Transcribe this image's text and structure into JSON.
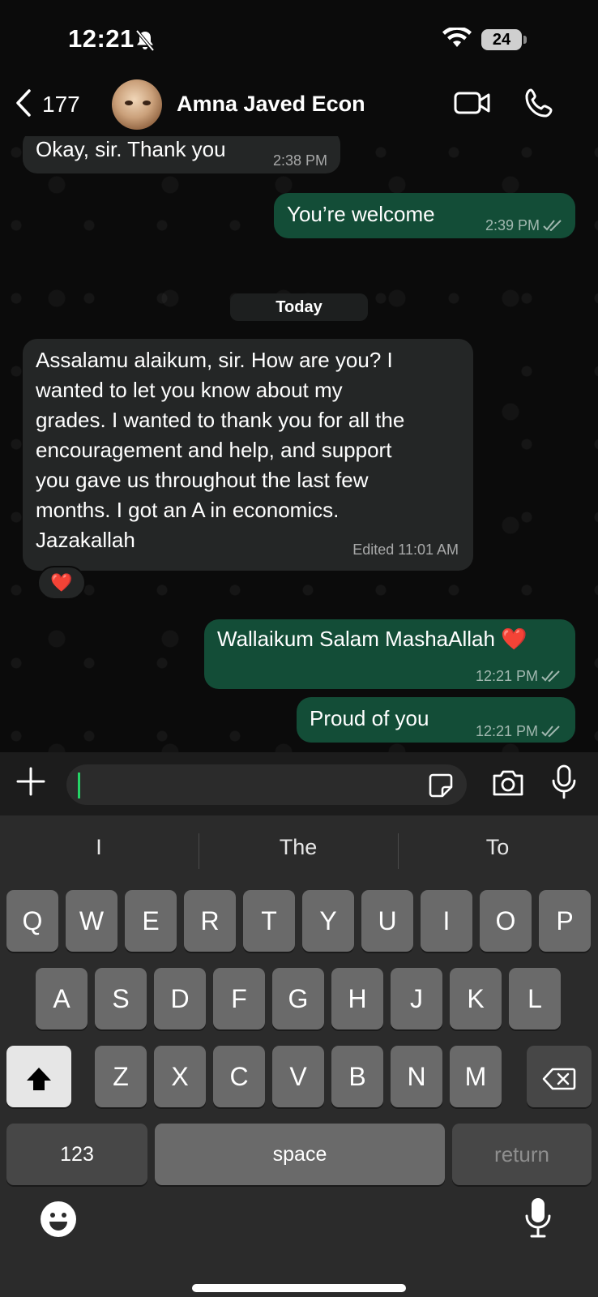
{
  "status_bar": {
    "time": "12:21",
    "battery": "24"
  },
  "header": {
    "back_count": "177",
    "contact_name": "Amna Javed Econ"
  },
  "messages": [
    {
      "direction": "in",
      "text": "Okay, sir. Thank you",
      "time": "2:38 PM"
    },
    {
      "direction": "out",
      "text": "You’re welcome",
      "time": "2:39 PM"
    },
    {
      "direction": "in",
      "text_lines": [
        "Assalamu alaikum, sir. How are you? I",
        "wanted to let you know about my",
        "grades. I wanted to thank you for all the",
        "encouragement and help, and support",
        "you gave us throughout the last few",
        "months. I got an A in economics.",
        "Jazakallah"
      ],
      "time": "Edited 11:01 AM",
      "reaction": "❤️"
    },
    {
      "direction": "out",
      "text": "Wallaikum Salam MashaAllah ❤️",
      "time": "12:21 PM"
    },
    {
      "direction": "out",
      "text": "Proud of you",
      "time": "12:21 PM"
    }
  ],
  "date_separator": "Today",
  "keyboard": {
    "suggestions": [
      "I",
      "The",
      "To"
    ],
    "row1": [
      "Q",
      "W",
      "E",
      "R",
      "T",
      "Y",
      "U",
      "I",
      "O",
      "P"
    ],
    "row2": [
      "A",
      "S",
      "D",
      "F",
      "G",
      "H",
      "J",
      "K",
      "L"
    ],
    "row3": [
      "Z",
      "X",
      "C",
      "V",
      "B",
      "N",
      "M"
    ],
    "numbers_label": "123",
    "space_label": "space",
    "return_label": "return"
  },
  "colors": {
    "outgoing_bubble": "#134d37",
    "incoming_bubble": "#242626",
    "accent": "#25d366"
  },
  "icons": [
    "bell-slash-icon",
    "wifi-icon",
    "battery-icon",
    "back-chevron-icon",
    "video-call-icon",
    "phone-icon",
    "plus-icon",
    "sticker-icon",
    "camera-icon",
    "microphone-icon",
    "shift-icon",
    "delete-icon",
    "emoji-icon",
    "dictation-icon",
    "read-receipt-icon"
  ]
}
